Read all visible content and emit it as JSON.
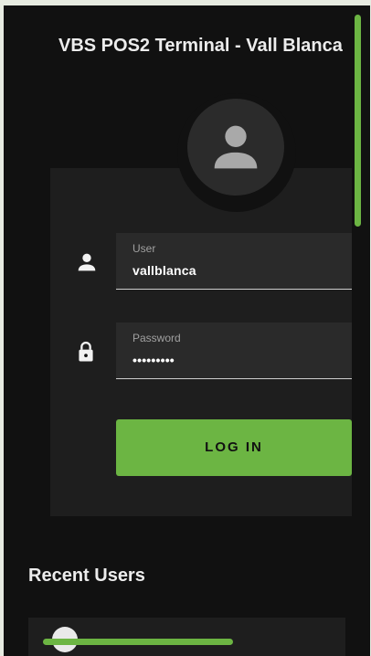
{
  "header": {
    "title": "VBS POS2 Terminal - Vall Blanca"
  },
  "login": {
    "avatar_icon": "person-icon",
    "user": {
      "icon": "person-icon",
      "label": "User",
      "value": "vallblanca"
    },
    "password": {
      "icon": "lock-icon",
      "label": "Password",
      "value": "•••••••••"
    },
    "button_label": "LOG IN"
  },
  "recent_users": {
    "title": "Recent Users"
  },
  "colors": {
    "accent": "#6cb543",
    "background": "#111111",
    "card": "#1e1e1e",
    "field": "#2a2a2a"
  }
}
